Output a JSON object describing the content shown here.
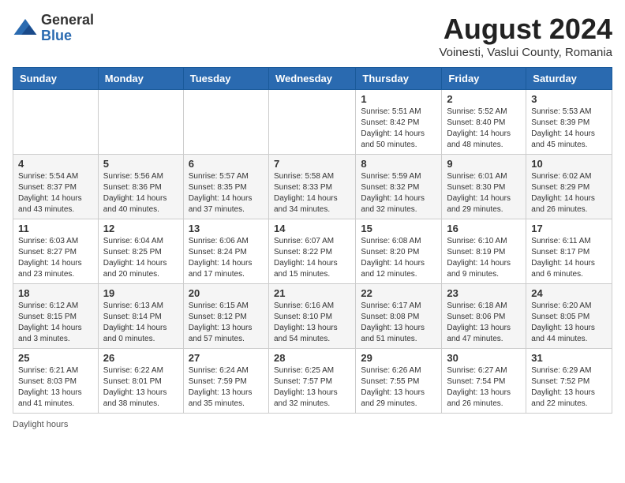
{
  "header": {
    "logo": {
      "general": "General",
      "blue": "Blue"
    },
    "title": "August 2024",
    "location": "Voinesti, Vaslui County, Romania"
  },
  "days_of_week": [
    "Sunday",
    "Monday",
    "Tuesday",
    "Wednesday",
    "Thursday",
    "Friday",
    "Saturday"
  ],
  "weeks": [
    [
      {
        "day": null,
        "info": null
      },
      {
        "day": null,
        "info": null
      },
      {
        "day": null,
        "info": null
      },
      {
        "day": null,
        "info": null
      },
      {
        "day": "1",
        "info": "Sunrise: 5:51 AM\nSunset: 8:42 PM\nDaylight: 14 hours\nand 50 minutes."
      },
      {
        "day": "2",
        "info": "Sunrise: 5:52 AM\nSunset: 8:40 PM\nDaylight: 14 hours\nand 48 minutes."
      },
      {
        "day": "3",
        "info": "Sunrise: 5:53 AM\nSunset: 8:39 PM\nDaylight: 14 hours\nand 45 minutes."
      }
    ],
    [
      {
        "day": "4",
        "info": "Sunrise: 5:54 AM\nSunset: 8:37 PM\nDaylight: 14 hours\nand 43 minutes."
      },
      {
        "day": "5",
        "info": "Sunrise: 5:56 AM\nSunset: 8:36 PM\nDaylight: 14 hours\nand 40 minutes."
      },
      {
        "day": "6",
        "info": "Sunrise: 5:57 AM\nSunset: 8:35 PM\nDaylight: 14 hours\nand 37 minutes."
      },
      {
        "day": "7",
        "info": "Sunrise: 5:58 AM\nSunset: 8:33 PM\nDaylight: 14 hours\nand 34 minutes."
      },
      {
        "day": "8",
        "info": "Sunrise: 5:59 AM\nSunset: 8:32 PM\nDaylight: 14 hours\nand 32 minutes."
      },
      {
        "day": "9",
        "info": "Sunrise: 6:01 AM\nSunset: 8:30 PM\nDaylight: 14 hours\nand 29 minutes."
      },
      {
        "day": "10",
        "info": "Sunrise: 6:02 AM\nSunset: 8:29 PM\nDaylight: 14 hours\nand 26 minutes."
      }
    ],
    [
      {
        "day": "11",
        "info": "Sunrise: 6:03 AM\nSunset: 8:27 PM\nDaylight: 14 hours\nand 23 minutes."
      },
      {
        "day": "12",
        "info": "Sunrise: 6:04 AM\nSunset: 8:25 PM\nDaylight: 14 hours\nand 20 minutes."
      },
      {
        "day": "13",
        "info": "Sunrise: 6:06 AM\nSunset: 8:24 PM\nDaylight: 14 hours\nand 17 minutes."
      },
      {
        "day": "14",
        "info": "Sunrise: 6:07 AM\nSunset: 8:22 PM\nDaylight: 14 hours\nand 15 minutes."
      },
      {
        "day": "15",
        "info": "Sunrise: 6:08 AM\nSunset: 8:20 PM\nDaylight: 14 hours\nand 12 minutes."
      },
      {
        "day": "16",
        "info": "Sunrise: 6:10 AM\nSunset: 8:19 PM\nDaylight: 14 hours\nand 9 minutes."
      },
      {
        "day": "17",
        "info": "Sunrise: 6:11 AM\nSunset: 8:17 PM\nDaylight: 14 hours\nand 6 minutes."
      }
    ],
    [
      {
        "day": "18",
        "info": "Sunrise: 6:12 AM\nSunset: 8:15 PM\nDaylight: 14 hours\nand 3 minutes."
      },
      {
        "day": "19",
        "info": "Sunrise: 6:13 AM\nSunset: 8:14 PM\nDaylight: 14 hours\nand 0 minutes."
      },
      {
        "day": "20",
        "info": "Sunrise: 6:15 AM\nSunset: 8:12 PM\nDaylight: 13 hours\nand 57 minutes."
      },
      {
        "day": "21",
        "info": "Sunrise: 6:16 AM\nSunset: 8:10 PM\nDaylight: 13 hours\nand 54 minutes."
      },
      {
        "day": "22",
        "info": "Sunrise: 6:17 AM\nSunset: 8:08 PM\nDaylight: 13 hours\nand 51 minutes."
      },
      {
        "day": "23",
        "info": "Sunrise: 6:18 AM\nSunset: 8:06 PM\nDaylight: 13 hours\nand 47 minutes."
      },
      {
        "day": "24",
        "info": "Sunrise: 6:20 AM\nSunset: 8:05 PM\nDaylight: 13 hours\nand 44 minutes."
      }
    ],
    [
      {
        "day": "25",
        "info": "Sunrise: 6:21 AM\nSunset: 8:03 PM\nDaylight: 13 hours\nand 41 minutes."
      },
      {
        "day": "26",
        "info": "Sunrise: 6:22 AM\nSunset: 8:01 PM\nDaylight: 13 hours\nand 38 minutes."
      },
      {
        "day": "27",
        "info": "Sunrise: 6:24 AM\nSunset: 7:59 PM\nDaylight: 13 hours\nand 35 minutes."
      },
      {
        "day": "28",
        "info": "Sunrise: 6:25 AM\nSunset: 7:57 PM\nDaylight: 13 hours\nand 32 minutes."
      },
      {
        "day": "29",
        "info": "Sunrise: 6:26 AM\nSunset: 7:55 PM\nDaylight: 13 hours\nand 29 minutes."
      },
      {
        "day": "30",
        "info": "Sunrise: 6:27 AM\nSunset: 7:54 PM\nDaylight: 13 hours\nand 26 minutes."
      },
      {
        "day": "31",
        "info": "Sunrise: 6:29 AM\nSunset: 7:52 PM\nDaylight: 13 hours\nand 22 minutes."
      }
    ]
  ],
  "footer": {
    "daylight_label": "Daylight hours"
  }
}
